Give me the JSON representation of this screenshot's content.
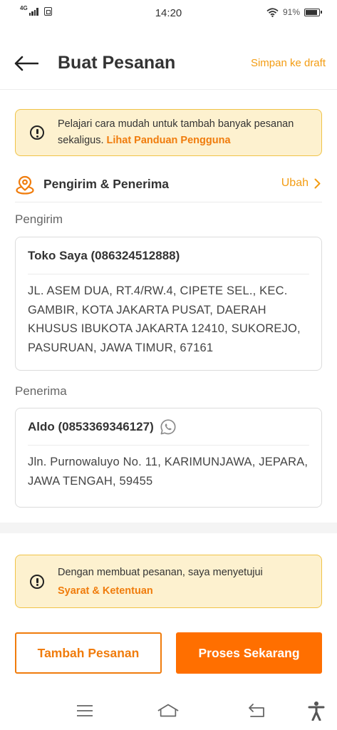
{
  "status_bar": {
    "network": "4G",
    "time": "14:20",
    "battery_percent": "91%",
    "battery_level": 0.91
  },
  "header": {
    "title": "Buat Pesanan",
    "draft_label": "Simpan ke draft"
  },
  "guide_notice": {
    "text": "Pelajari cara mudah untuk tambah banyak pesanan sekaligus. ",
    "link": "Lihat Panduan Pengguna"
  },
  "section": {
    "title": "Pengirim & Penerima",
    "edit_label": "Ubah"
  },
  "sender": {
    "label": "Pengirim",
    "name": "Toko Saya (086324512888)",
    "address": "JL. ASEM DUA, RT.4/RW.4, CIPETE SEL., KEC. GAMBIR, KOTA JAKARTA PUSAT, DAERAH KHUSUS IBUKOTA JAKARTA 12410, SUKOREJO, PASURUAN, JAWA TIMUR, 67161"
  },
  "receiver": {
    "label": "Penerima",
    "name": "Aldo (0853369346127)",
    "address": "Jln. Purnowaluyo No. 11, KARIMUNJAWA, JEPARA, JAWA TENGAH, 59455"
  },
  "terms_notice": {
    "text": "Dengan membuat pesanan, saya menyetujui",
    "link": "Syarat & Ketentuan"
  },
  "actions": {
    "add_order": "Tambah Pesanan",
    "process_now": "Proses Sekarang"
  },
  "colors": {
    "accent": "#f07c0c",
    "primary_button": "#ff6f00",
    "notice_bg": "#fdf1cf",
    "notice_border": "#f0c347"
  }
}
